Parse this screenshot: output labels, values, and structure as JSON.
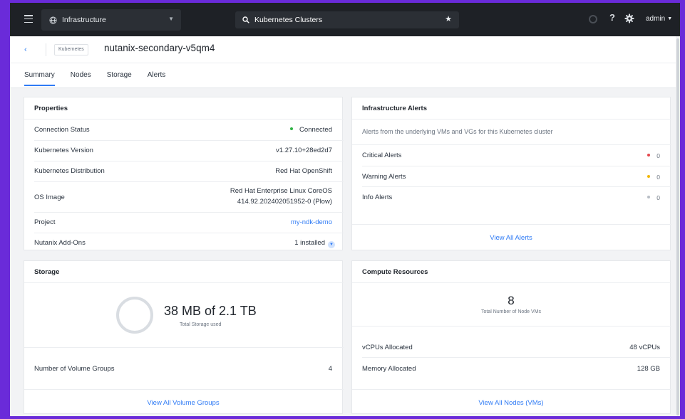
{
  "topbar": {
    "app_name": "Infrastructure",
    "search_query": "Kubernetes Clusters",
    "user": "admin"
  },
  "header": {
    "type_badge": "Kubernetes",
    "title": "nutanix-secondary-v5qm4",
    "tabs": [
      {
        "label": "Summary",
        "active": true
      },
      {
        "label": "Nodes"
      },
      {
        "label": "Storage"
      },
      {
        "label": "Alerts"
      }
    ]
  },
  "properties": {
    "title": "Properties",
    "rows": [
      {
        "label": "Connection Status",
        "value": "Connected"
      },
      {
        "label": "Kubernetes Version",
        "value": "v1.27.10+28ed2d7"
      },
      {
        "label": "Kubernetes Distribution",
        "value": "Red Hat OpenShift"
      },
      {
        "label": "OS Image",
        "value_line1": "Red Hat Enterprise Linux CoreOS",
        "value_line2": "414.92.202402051952-0 (Plow)"
      },
      {
        "label": "Project",
        "value": "my-ndk-demo"
      },
      {
        "label": "Nutanix Add-Ons",
        "value": "1 installed"
      }
    ]
  },
  "alerts": {
    "title": "Infrastructure Alerts",
    "description": "Alerts from the underlying VMs and VGs for this Kubernetes cluster",
    "rows": [
      {
        "label": "Critical Alerts",
        "count": "0",
        "color": "#e5484d"
      },
      {
        "label": "Warning Alerts",
        "count": "0",
        "color": "#f2b705"
      },
      {
        "label": "Info Alerts",
        "count": "0",
        "color": "#b8bec6"
      }
    ],
    "link": "View All Alerts"
  },
  "storage": {
    "title": "Storage",
    "used": "38 MB of 2.1 TB",
    "caption": "Total Storage used",
    "volume_groups_label": "Number of Volume Groups",
    "volume_groups_count": "4",
    "link": "View All Volume Groups"
  },
  "compute": {
    "title": "Compute Resources",
    "node_count": "8",
    "node_caption": "Total Number of Node VMs",
    "rows": [
      {
        "label": "vCPUs Allocated",
        "value": "48 vCPUs"
      },
      {
        "label": "Memory Allocated",
        "value": "128 GB"
      }
    ],
    "link": "View All Nodes (VMs)"
  },
  "colors": {
    "accent": "#2f7bf5",
    "connected": "#2fb344",
    "frame": "#6a2bd9"
  }
}
